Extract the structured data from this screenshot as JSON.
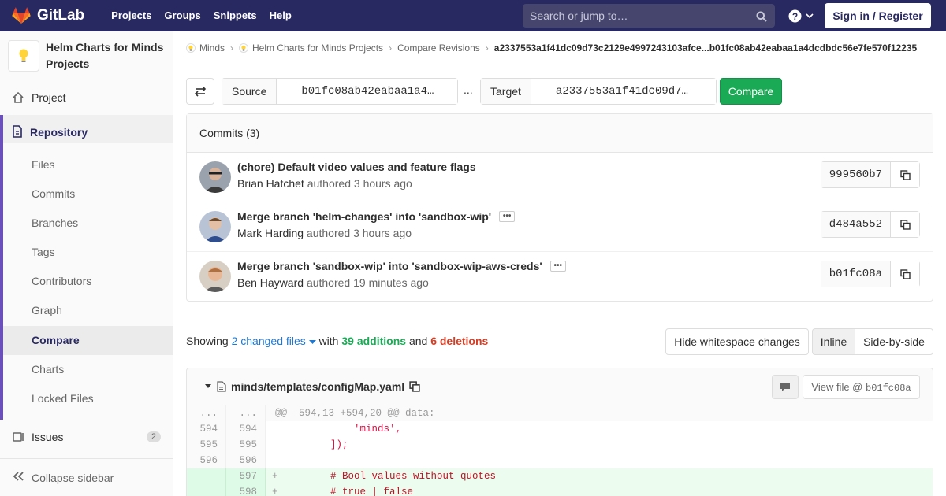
{
  "navbar": {
    "logo_text": "GitLab",
    "links": [
      "Projects",
      "Groups",
      "Snippets",
      "Help"
    ],
    "search_placeholder": "Search or jump to…",
    "signin_label": "Sign in / Register",
    "accent": "#292961"
  },
  "sidebar": {
    "project_name": "Helm Charts for Minds Projects",
    "project_label": "Project",
    "repository_label": "Repository",
    "repo_items": [
      "Files",
      "Commits",
      "Branches",
      "Tags",
      "Contributors",
      "Graph",
      "Compare",
      "Charts",
      "Locked Files"
    ],
    "active_item": "Compare",
    "issues_label": "Issues",
    "issues_count": "2",
    "collapse_label": "Collapse sidebar"
  },
  "breadcrumb": {
    "items": [
      "Minds",
      "Helm Charts for Minds Projects",
      "Compare Revisions"
    ],
    "current": "a2337553a1f41dc09d73c2129e4997243103afce...b01fc08ab42eabaa1a4dcdbdc56e7fe570f12235"
  },
  "compare_form": {
    "source_label": "Source",
    "source_value": "b01fc08ab42eabaa1a4…",
    "dots": "...",
    "target_label": "Target",
    "target_value": "a2337553a1f41dc09d7…",
    "compare_label": "Compare"
  },
  "commits": {
    "header": "Commits (3)",
    "rows": [
      {
        "title": "(chore) Default video values and feature flags",
        "author": "Brian Hatchet",
        "authored": "authored",
        "time": "3 hours ago",
        "sha": "999560b7"
      },
      {
        "title": "Merge branch 'helm-changes' into 'sandbox-wip'",
        "author": "Mark Harding",
        "authored": "authored",
        "time": "3 hours ago",
        "sha": "d484a552"
      },
      {
        "title": "Merge branch 'sandbox-wip' into 'sandbox-wip-aws-creds'",
        "author": "Ben Hayward",
        "authored": "authored",
        "time": "19 minutes ago",
        "sha": "b01fc08a"
      }
    ]
  },
  "stats": {
    "showing": "Showing",
    "files": "2 changed files",
    "with": "with",
    "additions": "39 additions",
    "and": "and",
    "deletions": "6 deletions",
    "hide_whitespace": "Hide whitespace changes",
    "inline": "Inline",
    "side_by_side": "Side-by-side"
  },
  "file": {
    "path": "minds/templates/configMap.yaml",
    "view_file_prefix": "View file @",
    "view_file_sha": "b01fc08a"
  },
  "diff": [
    {
      "type": "hunk",
      "old": "...",
      "new": "...",
      "code": "@@ -594,13 +594,20 @@ data:"
    },
    {
      "type": "ctx",
      "old": "594",
      "new": "594",
      "code": "            'minds',",
      "str": true
    },
    {
      "type": "ctx",
      "old": "595",
      "new": "595",
      "code": "        ]);",
      "str": true
    },
    {
      "type": "ctx",
      "old": "596",
      "new": "596",
      "code": ""
    },
    {
      "type": "add",
      "old": "",
      "new": "597",
      "code": "        # Bool values without quotes",
      "cmt": true
    },
    {
      "type": "add",
      "old": "",
      "new": "598",
      "code": "        # true | false",
      "cmt": true
    }
  ]
}
